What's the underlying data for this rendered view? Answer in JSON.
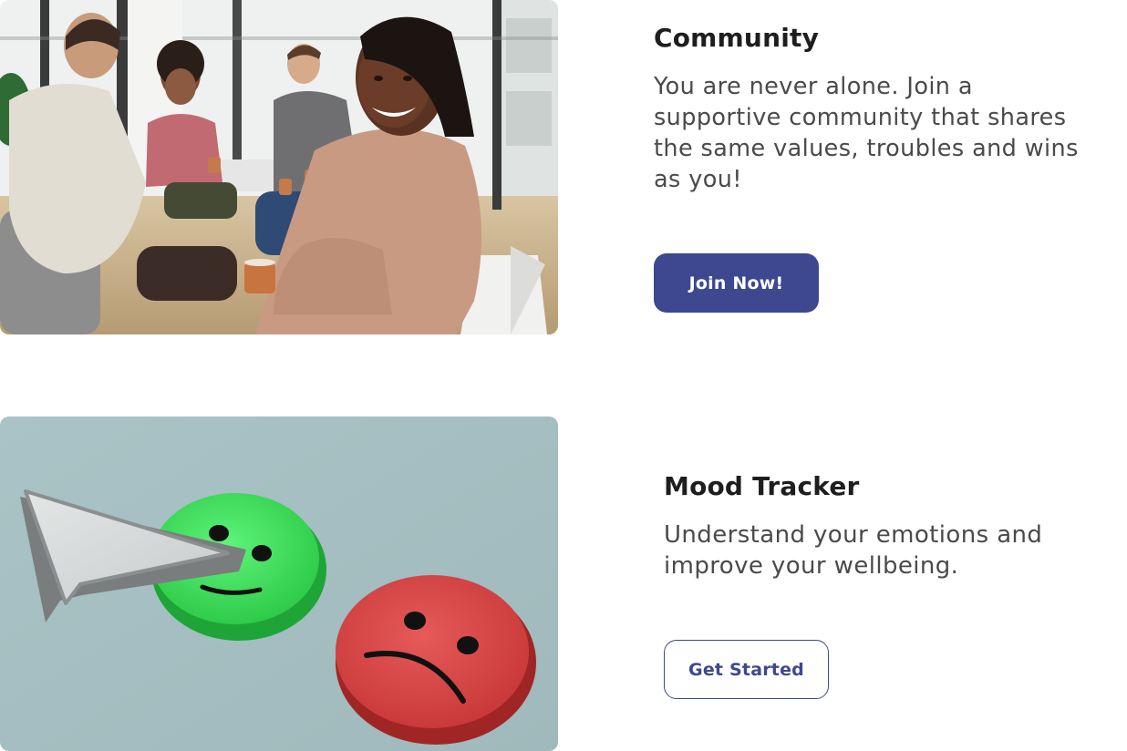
{
  "community": {
    "heading": "Community",
    "description": "You are never alone. Join a supportive community that shares the same values, troubles and wins as you!",
    "button_label": "Join Now!"
  },
  "mood_tracker": {
    "heading": "Mood Tracker",
    "description": "Understand your emotions and improve your wellbeing.",
    "button_label": "Get Started"
  },
  "colors": {
    "brand": "#3d4891",
    "heading_text": "#1e1e1e",
    "body_text": "#4a4a4a"
  }
}
